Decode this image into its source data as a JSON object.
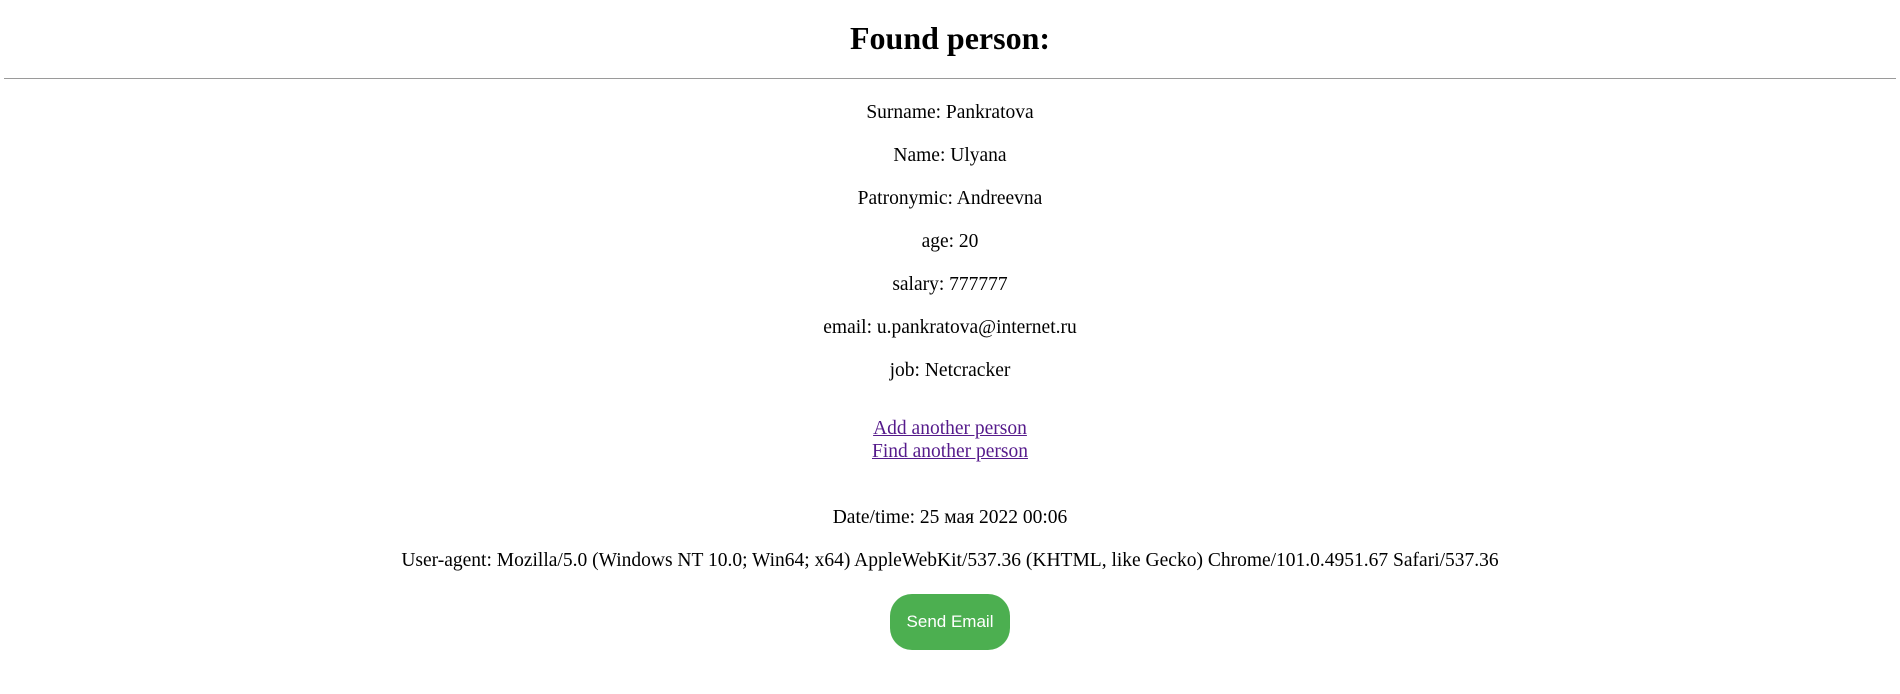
{
  "header": {
    "title": "Found person:"
  },
  "person": {
    "surname": "Surname: Pankratova",
    "name": "Name: Ulyana",
    "patronymic": "Patronymic: Andreevna",
    "age": "age: 20",
    "salary": "salary: 777777",
    "email": "email: u.pankratova@internet.ru",
    "job": "job: Netcracker"
  },
  "links": {
    "add": "Add another person",
    "find": "Find another person"
  },
  "meta": {
    "datetime": "Date/time: 25 мая 2022 00:06",
    "user_agent": "User-agent: Mozilla/5.0 (Windows NT 10.0; Win64; x64) AppleWebKit/537.36 (KHTML, like Gecko) Chrome/101.0.4951.67 Safari/537.36"
  },
  "actions": {
    "send_email": "Send Email"
  },
  "colors": {
    "button_bg": "#4caf50",
    "visited_link": "#551a8b"
  }
}
